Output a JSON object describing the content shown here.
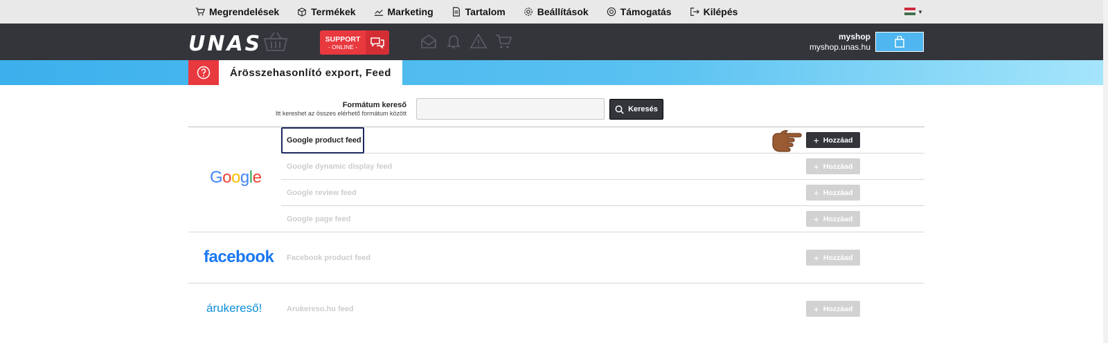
{
  "topnav": {
    "items": [
      {
        "label": "Megrendelések",
        "icon": "cart-icon"
      },
      {
        "label": "Termékek",
        "icon": "box-icon"
      },
      {
        "label": "Marketing",
        "icon": "chart-icon"
      },
      {
        "label": "Tartalom",
        "icon": "document-icon"
      },
      {
        "label": "Beállítások",
        "icon": "gear-icon"
      },
      {
        "label": "Támogatás",
        "icon": "lifebuoy-icon"
      },
      {
        "label": "Kilépés",
        "icon": "logout-icon"
      }
    ],
    "language_flag": "hungarian-flag-icon"
  },
  "header": {
    "logo": "UNAS",
    "support_line1": "SUPPORT",
    "support_line2": "- ONLINE -",
    "shop_name": "myshop",
    "shop_domain": "myshop.unas.hu"
  },
  "page": {
    "title": "Árösszehasonlító export, Feed"
  },
  "search": {
    "label": "Formátum kereső",
    "hint": "Itt kereshet az összes elérhető formátum között",
    "value": "",
    "placeholder": "",
    "button": "Keresés"
  },
  "groups": [
    {
      "brand": "Google",
      "feeds": [
        {
          "name": "Google product feed",
          "action": "Hozzáad",
          "enabled": true
        },
        {
          "name": "Google dynamic display feed",
          "action": "Hozzáad",
          "enabled": false
        },
        {
          "name": "Google review feed",
          "action": "Hozzáad",
          "enabled": false
        },
        {
          "name": "Google page feed",
          "action": "Hozzáad",
          "enabled": false
        }
      ]
    },
    {
      "brand": "facebook",
      "feeds": [
        {
          "name": "Facebook product feed",
          "action": "Hozzáad",
          "enabled": false
        }
      ]
    },
    {
      "brand": "árukereső!",
      "feeds": [
        {
          "name": "Arukereso.hu feed",
          "action": "Hozzáad",
          "enabled": false
        }
      ]
    }
  ],
  "colors": {
    "accent_red": "#e8393f",
    "header_dark": "#33353b",
    "band_blue": "#3cb0ec",
    "facebook_blue": "#1877f2"
  }
}
